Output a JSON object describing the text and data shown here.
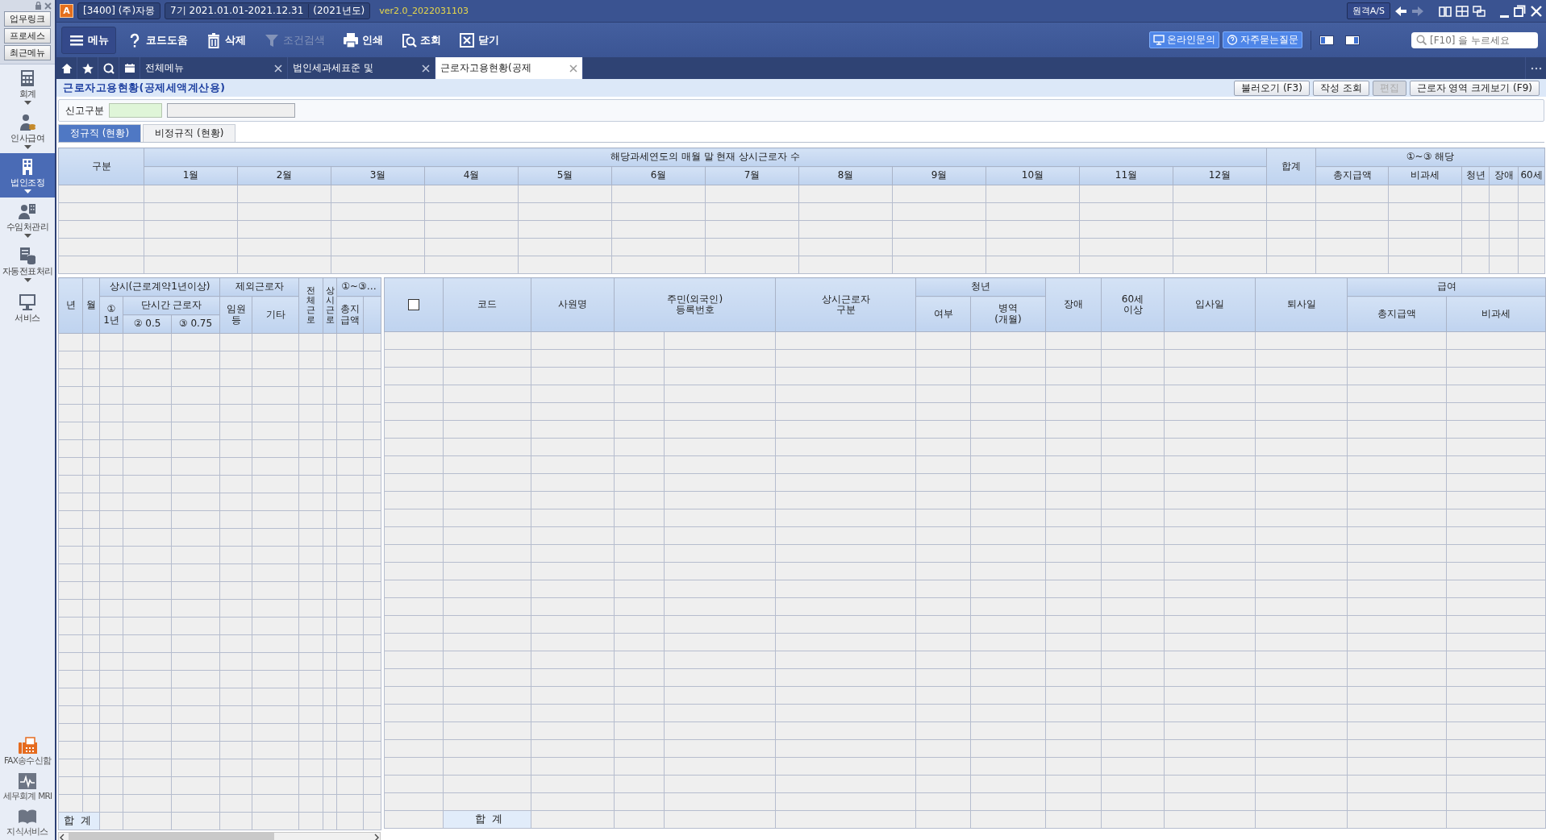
{
  "title_bar": {
    "app_badge": "A",
    "company": "[3400] (주)자몽",
    "period": "7기 2021.01.01-2021.12.31",
    "fiscal_year": "(2021년도)",
    "version": "ver2.0_2022031103",
    "remote_button": "원격A/S"
  },
  "sidebar": {
    "quick_buttons": [
      "업무링크",
      "프로세스",
      "최근메뉴"
    ],
    "items": [
      {
        "label": "회계",
        "selected": false,
        "expandable": true
      },
      {
        "label": "인사급여",
        "selected": false,
        "expandable": true
      },
      {
        "label": "법인조정",
        "selected": true,
        "expandable": true
      },
      {
        "label": "수임처관리",
        "selected": false,
        "expandable": true
      },
      {
        "label": "자동전표처리",
        "selected": false,
        "expandable": true
      },
      {
        "label": "서비스",
        "selected": false,
        "expandable": false
      }
    ],
    "bottom_items": [
      "FAX송수신함",
      "세무회계 MRI",
      "지식서비스"
    ]
  },
  "toolbar": {
    "buttons": [
      {
        "label": "메뉴",
        "disabled": false
      },
      {
        "label": "코드도움",
        "disabled": false
      },
      {
        "label": "삭제",
        "disabled": false
      },
      {
        "label": "조건검색",
        "disabled": true
      },
      {
        "label": "인쇄",
        "disabled": false
      },
      {
        "label": "조회",
        "disabled": false
      },
      {
        "label": "닫기",
        "disabled": false
      }
    ],
    "online_inquiry": "온라인문의",
    "faq": "자주묻는질문",
    "search": {
      "placeholder": "[F10] 을 누르세요"
    }
  },
  "tabs": [
    {
      "label": "전체메뉴",
      "selected": false
    },
    {
      "label": "법인세과세표준 및",
      "selected": false
    },
    {
      "label": "근로자고용현황(공제",
      "selected": true
    }
  ],
  "page": {
    "title": "근로자고용현황(공제세액계산용)",
    "actions": [
      {
        "label": "불러오기 (F3)",
        "disabled": false
      },
      {
        "label": "작성 조회",
        "disabled": false
      },
      {
        "label": "편집",
        "disabled": true
      },
      {
        "label": "근로자 영역 크게보기 (F9)",
        "disabled": false
      }
    ]
  },
  "filter": {
    "label": "신고구분"
  },
  "sub_tabs": [
    {
      "label": "정규직 (현황)",
      "selected": true
    },
    {
      "label": "비정규직 (현황)",
      "selected": false
    }
  ],
  "monthly_table": {
    "row_header": "구분",
    "group_header": "해당과세연도의 매월 말 현재 상시근로자 수",
    "months": [
      "1월",
      "2월",
      "3월",
      "4월",
      "5월",
      "6월",
      "7월",
      "8월",
      "9월",
      "10월",
      "11월",
      "12월"
    ],
    "total": "합계",
    "side_group": "①~③ 해당",
    "side_columns": [
      "총지급액",
      "비과세",
      "청년",
      "장애",
      "60세"
    ]
  },
  "count_table": {
    "year": "년",
    "month": "월",
    "regular_group": "상시(근로계약1년이상)",
    "one_year": "①\n1년",
    "part_time_group": "단시간 근로자",
    "part_half": "② 0.5",
    "part_three_quarter": "③ 0.75",
    "excluded_group": "제외근로자",
    "executives": "임원\n등",
    "other": "기타",
    "all_workers": "전체근로",
    "regular_workers": "상시근로",
    "sum_group": "①~③…",
    "total_pay": "총지급액",
    "total_label": "합 계"
  },
  "employee_table": {
    "select_all_checked": false,
    "code": "코드",
    "name": "사원명",
    "resident_id": "주민(외국인)\n등록번호",
    "regular_type": "상시근로자\n구분",
    "youth_group": "청년",
    "youth_flag": "여부",
    "military": "병역\n(개월)",
    "disabled": "장애",
    "over_60": "60세\n이상",
    "hire_date": "입사일",
    "leave_date": "퇴사일",
    "pay_group": "급여",
    "total_pay": "총지급액",
    "non_taxable": "비과세",
    "total_label": "합 계"
  }
}
